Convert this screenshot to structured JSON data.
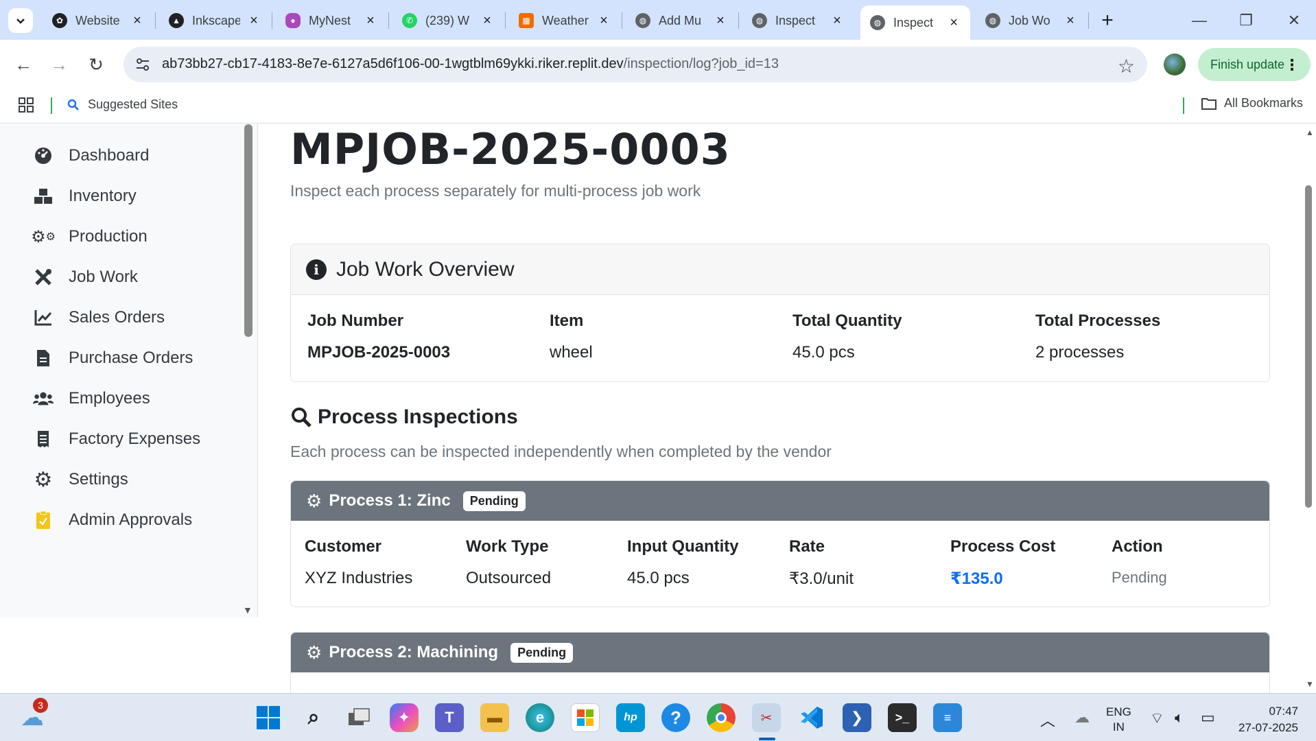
{
  "browser": {
    "tabs": [
      {
        "label": "Website",
        "favicon": "openai-icon",
        "color": "#202124"
      },
      {
        "label": "Inkscape",
        "favicon": "inkscape-icon",
        "color": "#202124"
      },
      {
        "label": "MyNest",
        "favicon": "mynest-icon",
        "color": "#9c27b0"
      },
      {
        "label": "(239) W",
        "favicon": "whatsapp-icon",
        "color": "#25d366"
      },
      {
        "label": "Weather",
        "favicon": "weather-icon",
        "color": "#f57c00"
      },
      {
        "label": "Add Mu",
        "favicon": "globe-icon",
        "color": "#5f6368"
      },
      {
        "label": "Inspect",
        "favicon": "globe-icon",
        "color": "#5f6368"
      },
      {
        "label": "Inspect",
        "favicon": "globe-icon",
        "color": "#5f6368",
        "active": true
      },
      {
        "label": "Job Wo",
        "favicon": "globe-icon",
        "color": "#5f6368"
      }
    ],
    "url_host": "ab73bb27-cb17-4183-8e7e-6127a5d6f106-00-1wgtblm69ykki.riker.replit.dev",
    "url_path": "/inspection/log?job_id=13",
    "finish_update": "Finish update",
    "bookmarks": {
      "suggested": "Suggested Sites",
      "all": "All Bookmarks"
    }
  },
  "sidebar": {
    "items": [
      {
        "label": "Dashboard",
        "icon": "dashboard-gauge-icon"
      },
      {
        "label": "Inventory",
        "icon": "boxes-icon"
      },
      {
        "label": "Production",
        "icon": "cogs-icon"
      },
      {
        "label": "Job Work",
        "icon": "tools-icon"
      },
      {
        "label": "Sales Orders",
        "icon": "chart-line-icon"
      },
      {
        "label": "Purchase Orders",
        "icon": "file-icon"
      },
      {
        "label": "Employees",
        "icon": "users-icon"
      },
      {
        "label": "Factory Expenses",
        "icon": "receipt-icon"
      },
      {
        "label": "Settings",
        "icon": "gear-icon"
      },
      {
        "label": "Admin Approvals",
        "icon": "clipboard-check-icon"
      }
    ]
  },
  "page": {
    "title": "MPJOB-2025-0003",
    "subtitle": "Inspect each process separately for multi-process job work",
    "overview": {
      "heading": "Job Work Overview",
      "fields": [
        {
          "label": "Job Number",
          "value": "MPJOB-2025-0003",
          "bold": true
        },
        {
          "label": "Item",
          "value": "wheel"
        },
        {
          "label": "Total Quantity",
          "value": "45.0 pcs"
        },
        {
          "label": "Total Processes",
          "value": "2 processes"
        }
      ]
    },
    "process_section": {
      "heading": "Process Inspections",
      "subtitle": "Each process can be inspected independently when completed by the vendor"
    },
    "processes": [
      {
        "title": "Process 1: Zinc",
        "status": "Pending",
        "headers": [
          "Customer",
          "Work Type",
          "Input Quantity",
          "Rate",
          "Process Cost",
          "Action"
        ],
        "values": [
          "XYZ Industries",
          "Outsourced",
          "45.0 pcs",
          "₹3.0/unit",
          "₹135.0",
          "Pending"
        ]
      },
      {
        "title": "Process 2: Machining",
        "status": "Pending"
      }
    ]
  },
  "taskbar": {
    "weather_badge": "3",
    "lang_line1": "ENG",
    "lang_line2": "IN",
    "time": "07:47",
    "date": "27-07-2025"
  },
  "colors": {
    "accent_blue": "#0d6efd",
    "process_header": "#6c757d",
    "tabstrip": "#d3e3fd"
  }
}
